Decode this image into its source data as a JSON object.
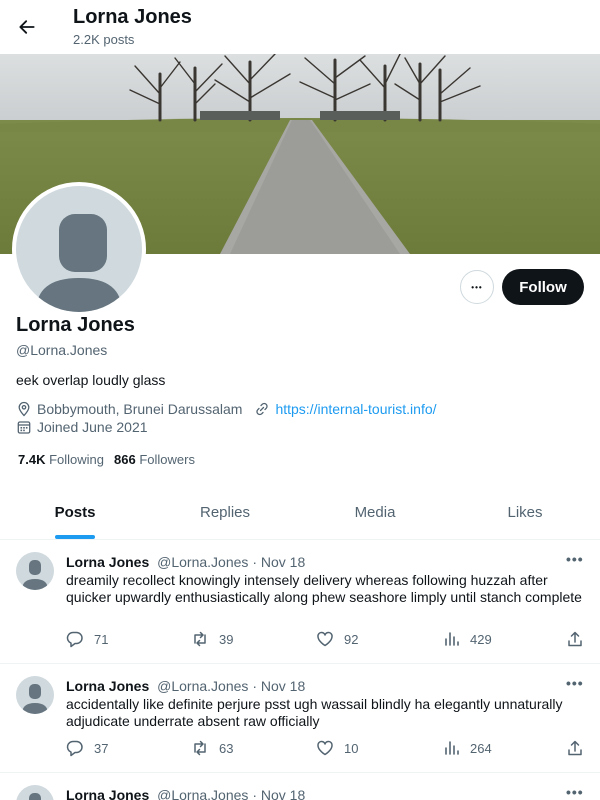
{
  "header": {
    "title": "Lorna Jones",
    "posts_count": "2.2K posts"
  },
  "profile": {
    "name": "Lorna Jones",
    "handle": "@Lorna.Jones",
    "bio": "eek overlap loudly glass",
    "location": "Bobbymouth, Brunei Darussalam",
    "website": "https://internal-tourist.info/",
    "joined": "Joined June 2021",
    "following_count": "7.4K",
    "following_label": "Following",
    "followers_count": "866",
    "followers_label": "Followers",
    "follow_label": "Follow",
    "more_label": "•••"
  },
  "tabs": [
    {
      "label": "Posts",
      "active": true
    },
    {
      "label": "Replies",
      "active": false
    },
    {
      "label": "Media",
      "active": false
    },
    {
      "label": "Likes",
      "active": false
    }
  ],
  "posts": [
    {
      "name": "Lorna Jones",
      "handle": "@Lorna.Jones",
      "separator": "·",
      "date": "Nov 18",
      "more": "•••",
      "text": "dreamily recollect knowingly intensely delivery whereas following huzzah after quicker upwardly enthusiastically along phew seashore limply until stanch complete",
      "replies": "71",
      "reposts": "39",
      "likes": "92",
      "views": "429"
    },
    {
      "name": "Lorna Jones",
      "handle": "@Lorna.Jones",
      "separator": "·",
      "date": "Nov 18",
      "more": "•••",
      "text": "accidentally like definite perjure psst ugh wassail blindly ha elegantly unnaturally adjudicate underrate absent raw officially",
      "replies": "37",
      "reposts": "63",
      "likes": "10",
      "views": "264"
    },
    {
      "name": "Lorna Jones",
      "handle": "@Lorna.Jones",
      "separator": "·",
      "date": "Nov 18",
      "more": "•••"
    }
  ],
  "colors": {
    "accent": "#1d9bf0",
    "text_primary": "#0f1419",
    "text_secondary": "#536471",
    "follow_button": "#0f1419"
  }
}
